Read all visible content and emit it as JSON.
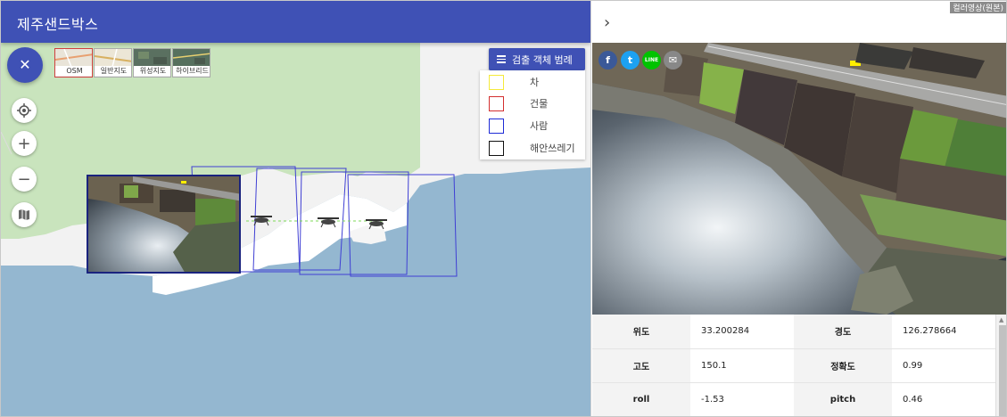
{
  "app": {
    "title": "제주샌드박스"
  },
  "map": {
    "close_icon": "close-icon",
    "controls": [
      "locate-icon",
      "zoom-in-icon",
      "zoom-out-icon",
      "map-icon"
    ],
    "zoom_in_label": "+",
    "zoom_out_label": "−",
    "layers": [
      {
        "label": "OSM",
        "active": true
      },
      {
        "label": "일반지도",
        "active": false
      },
      {
        "label": "위성지도",
        "active": false
      },
      {
        "label": "하이브리드",
        "active": false
      }
    ],
    "legend_button": "검출 객체 범례",
    "legend": [
      {
        "label": "차",
        "color": "#f5ea3a"
      },
      {
        "label": "건물",
        "color": "#d32f2f"
      },
      {
        "label": "사람",
        "color": "#1e2bd6"
      },
      {
        "label": "해안쓰레기",
        "color": "#111111"
      }
    ],
    "colors": {
      "water": "#94b7d0",
      "land": "#f2f2f2",
      "park": "#c9e4bd",
      "footprint": "#3f3fd4"
    }
  },
  "panel": {
    "collapse_icon": "chevron-right-icon",
    "photo_label": "컬러영상(원본)",
    "share": [
      {
        "name": "facebook-icon",
        "glyph": "f",
        "color": "#3b5998"
      },
      {
        "name": "twitter-icon",
        "glyph": "t",
        "color": "#1da1f2"
      },
      {
        "name": "line-icon",
        "glyph": "LINE",
        "color": "#00c300"
      },
      {
        "name": "email-icon",
        "glyph": "✉",
        "color": "#888888"
      }
    ],
    "info": [
      {
        "k1": "위도",
        "v1": "33.200284",
        "k2": "경도",
        "v2": "126.278664"
      },
      {
        "k1": "고도",
        "v1": "150.1",
        "k2": "정확도",
        "v2": "0.99"
      },
      {
        "k1": "roll",
        "v1": "-1.53",
        "k2": "pitch",
        "v2": "0.46"
      }
    ]
  }
}
